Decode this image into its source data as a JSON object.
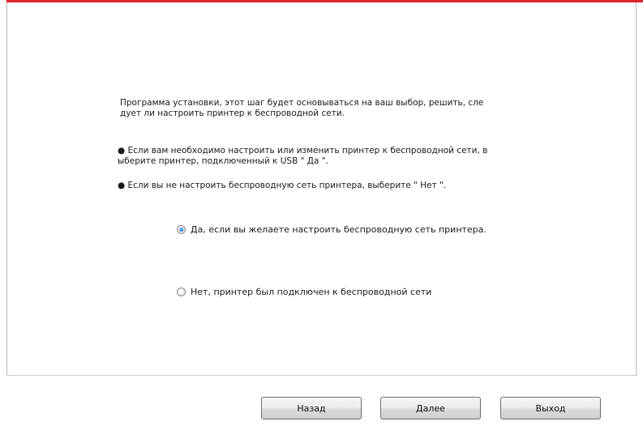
{
  "content": {
    "intro": "Программа установки, этот шаг будет основываться на ваш выбор, решить, сле\nдует ли настроить принтер к беспроводной сети.",
    "bullet1": "● Если вам необходимо настроить или изменить принтер к беспроводной сети, в\nыберите принтер, подключенный к USB \" Да \".",
    "bullet2": "● Если вы не настроить беспроводную сеть принтера, выберите \" Нет \"."
  },
  "options": {
    "yes_label": "Да, если вы желаете настроить беспроводную сеть принтера.",
    "no_label": "Нет, принтер был подключен к беспроводной сети",
    "selected": "yes"
  },
  "buttons": {
    "back": "Назад",
    "next": "Далее",
    "exit": "Выход"
  },
  "colors": {
    "accent": "#d9262d",
    "radio_selected": "#1d6fd1"
  }
}
